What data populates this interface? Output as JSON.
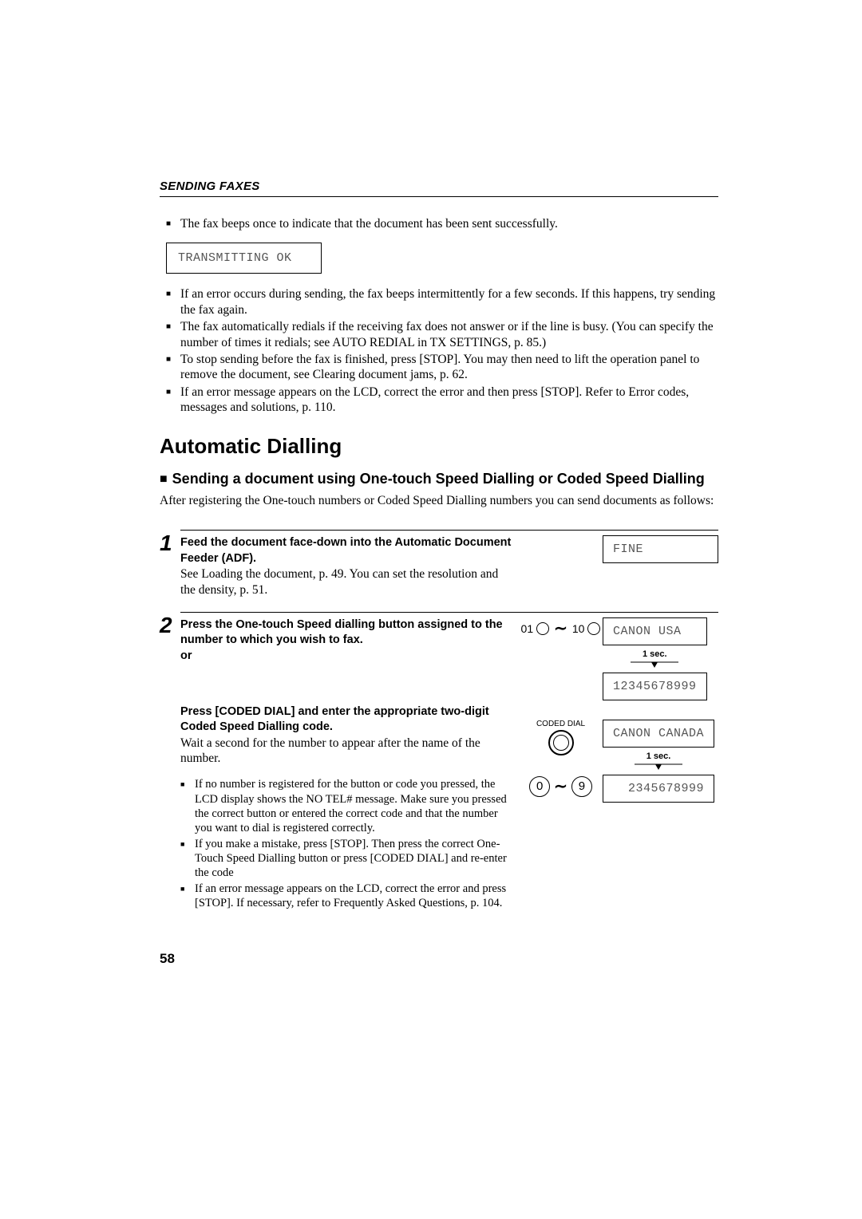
{
  "header": "SENDING FAXES",
  "intro_bullet": "The fax beeps once to indicate that the document has been sent successfully.",
  "lcd_transmitting": "TRANSMITTING OK",
  "after_bullets": [
    "If an error occurs during sending, the fax beeps intermittently for a few seconds. If this happens, try sending the fax again.",
    "The fax automatically redials if the receiving fax does not answer or if the line is busy. (You can specify the number of times it redials; see AUTO REDIAL in TX SETTINGS, p. 85.)",
    "To stop sending before the fax is finished, press [STOP]. You may then need to lift the operation panel to remove the document, see Clearing document jams, p. 62.",
    "If an error message appears on the LCD, correct the error and then press [STOP]. Refer to Error codes, messages and solutions, p. 110."
  ],
  "h2": "Automatic Dialling",
  "h3": "Sending a document using One-touch Speed Dialling or Coded Speed Dialling",
  "h3_intro": "After registering the One-touch numbers or Coded Speed Dialling numbers you can send documents as follows:",
  "step1": {
    "num": "1",
    "bold": "Feed the document face-down into the Automatic Document Feeder (ADF).",
    "rest": "See Loading the document, p. 49. You can set the resolution and the density, p. 51.",
    "lcd": "FINE"
  },
  "step2": {
    "num": "2",
    "bold": "Press the One-touch Speed dialling button assigned to the number to which you wish to fax.",
    "or": "or",
    "range_lo": "01",
    "range_hi": "10",
    "lcd_name1": "CANON USA",
    "delay": "1 sec.",
    "lcd_num1": "12345678999",
    "coded_bold": "Press [CODED DIAL] and enter the appropriate two-digit Coded Speed Dialling code.",
    "coded_rest": "Wait a second for the number to appear after the name of the number.",
    "coded_label": "CODED DIAL",
    "lcd_name2": "CANON CANADA",
    "lcd_num2": "2345678999",
    "digit_lo": "0",
    "digit_hi": "9",
    "bullets": [
      "If no number is registered for the button or code you pressed, the LCD display shows the NO TEL# message. Make sure you pressed the correct button or entered the correct code and that the number you want to dial is registered correctly.",
      "If you make a mistake, press [STOP]. Then press the correct One-Touch Speed Dialling button or press [CODED DIAL] and re-enter the code",
      "If an error message appears on the LCD, correct the error and press [STOP]. If necessary, refer to Frequently Asked Questions, p. 104."
    ]
  },
  "page_number": "58"
}
